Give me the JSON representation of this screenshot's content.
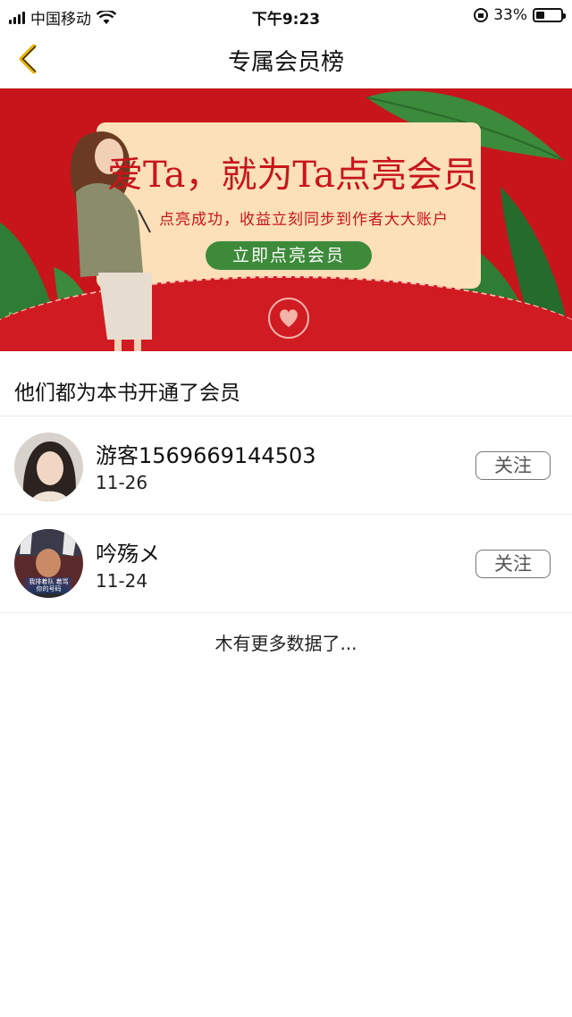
{
  "status_bar": {
    "carrier": "中国移动",
    "time": "下午9:23",
    "battery": "33%",
    "battery_level": 0.33
  },
  "nav": {
    "title": "专属会员榜",
    "back_icon": "chevron-left-icon"
  },
  "banner": {
    "headline": "爱Ta，就为Ta点亮会员",
    "subline": "点亮成功，收益立刻同步到作者大大账户",
    "cta": "立即点亮会员",
    "colors": {
      "background": "#c8151c",
      "card": "#fbe0b9",
      "cta": "#3d8a3a"
    }
  },
  "section": {
    "title": "他们都为本书开通了会员"
  },
  "members": [
    {
      "name": "游客1569669144503",
      "date": "11-26",
      "follow_label": "关注"
    },
    {
      "name": "吟殇メ",
      "date": "11-24",
      "follow_label": "关注",
      "avatar_caption": "我排着队 着骂你的号码"
    }
  ],
  "footer": {
    "no_more": "木有更多数据了..."
  },
  "colors": {
    "accent": "#e8b400",
    "text": "#111111"
  }
}
